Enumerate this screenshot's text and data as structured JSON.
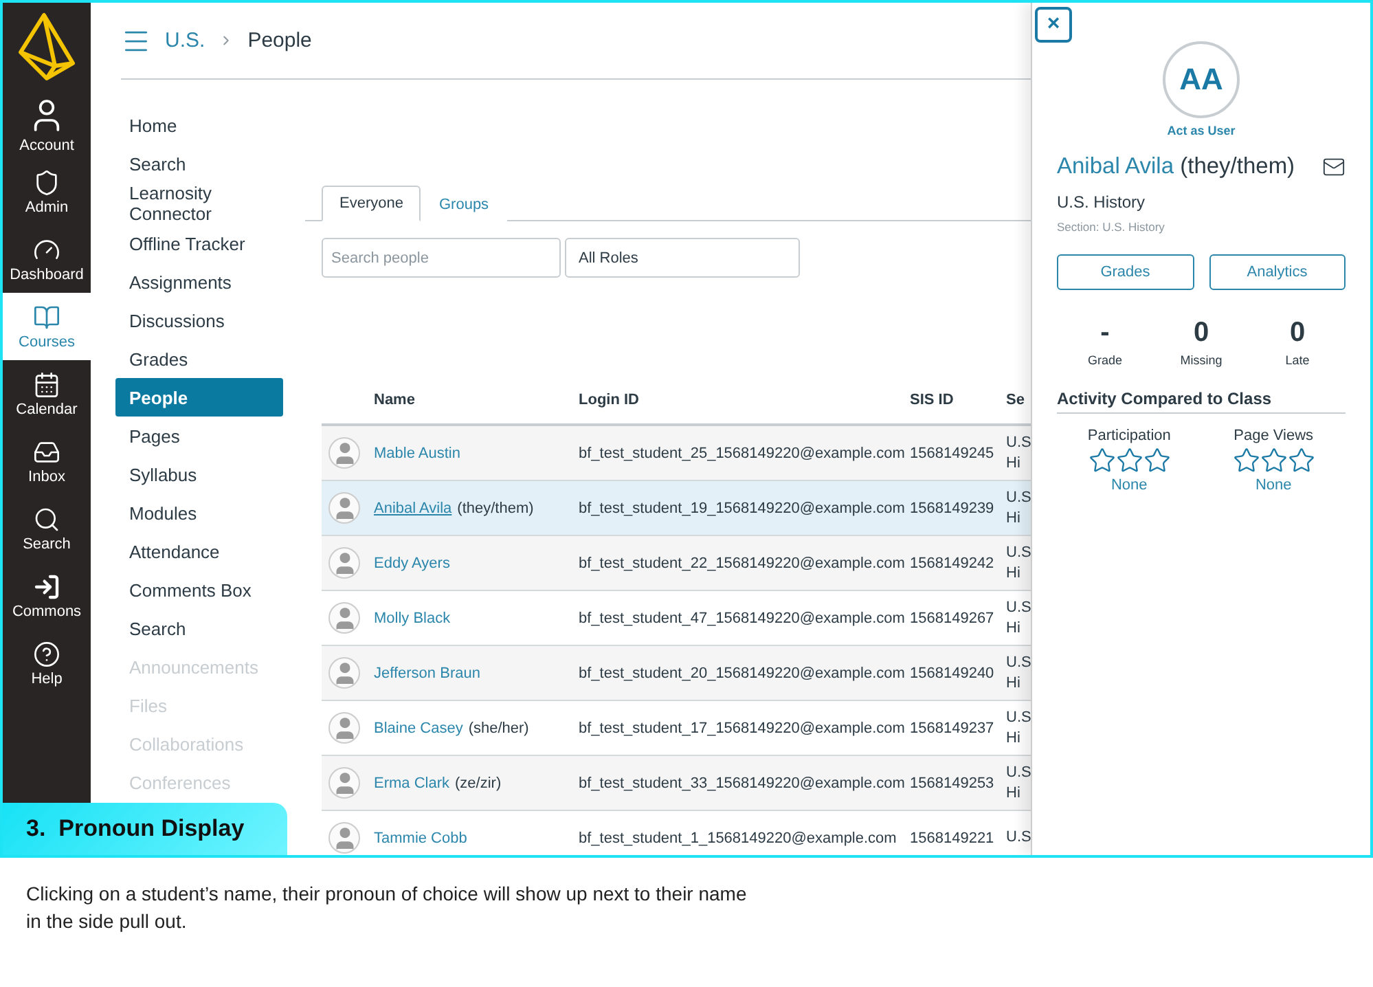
{
  "global_nav": [
    {
      "kind": "account",
      "label": "Account",
      "selected": false
    },
    {
      "kind": "admin",
      "label": "Admin",
      "selected": false
    },
    {
      "kind": "dashboard",
      "label": "Dashboard",
      "selected": false
    },
    {
      "kind": "courses",
      "label": "Courses",
      "selected": true
    },
    {
      "kind": "calendar",
      "label": "Calendar",
      "selected": false
    },
    {
      "kind": "inbox",
      "label": "Inbox",
      "selected": false
    },
    {
      "kind": "search",
      "label": "Search",
      "selected": false
    },
    {
      "kind": "commons",
      "label": "Commons",
      "selected": false
    },
    {
      "kind": "help",
      "label": "Help",
      "selected": false
    }
  ],
  "breadcrumb": [
    "U.S.",
    "People"
  ],
  "course_nav": [
    {
      "label": "Home",
      "selected": false,
      "disabled": false
    },
    {
      "label": "Search",
      "selected": false,
      "disabled": false
    },
    {
      "label": "Learnosity Connector",
      "selected": false,
      "disabled": false
    },
    {
      "label": "Offline Tracker",
      "selected": false,
      "disabled": false
    },
    {
      "label": "Assignments",
      "selected": false,
      "disabled": false
    },
    {
      "label": "Discussions",
      "selected": false,
      "disabled": false
    },
    {
      "label": "Grades",
      "selected": false,
      "disabled": false
    },
    {
      "label": "People",
      "selected": true,
      "disabled": false
    },
    {
      "label": "Pages",
      "selected": false,
      "disabled": false
    },
    {
      "label": "Syllabus",
      "selected": false,
      "disabled": false
    },
    {
      "label": "Modules",
      "selected": false,
      "disabled": false
    },
    {
      "label": "Attendance",
      "selected": false,
      "disabled": false
    },
    {
      "label": "Comments Box",
      "selected": false,
      "disabled": false
    },
    {
      "label": "Search",
      "selected": false,
      "disabled": false
    },
    {
      "label": "Announcements",
      "selected": false,
      "disabled": true
    },
    {
      "label": "Files",
      "selected": false,
      "disabled": true
    },
    {
      "label": "Collaborations",
      "selected": false,
      "disabled": true
    },
    {
      "label": "Conferences",
      "selected": false,
      "disabled": true
    }
  ],
  "tabs": [
    {
      "label": "Everyone",
      "selected": true
    },
    {
      "label": "Groups",
      "selected": false
    }
  ],
  "search": {
    "placeholder": "Search people"
  },
  "role_filter": {
    "value": "All Roles"
  },
  "table": {
    "columns": [
      "Name",
      "Login ID",
      "SIS ID",
      "Se"
    ],
    "rows": [
      {
        "name": "Mable Austin",
        "login_id": "bf_test_student_25_1568149220@example.com",
        "sis_id": "1568149245",
        "section": [
          "U.S",
          "Hi"
        ],
        "selected": false
      },
      {
        "name": "Anibal Avila",
        "pronouns": "(they/them)",
        "login_id": "bf_test_student_19_1568149220@example.com",
        "sis_id": "1568149239",
        "section": [
          "U.S",
          "Hi"
        ],
        "selected": true
      },
      {
        "name": "Eddy Ayers",
        "login_id": "bf_test_student_22_1568149220@example.com",
        "sis_id": "1568149242",
        "section": [
          "U.S",
          "Hi"
        ],
        "selected": false
      },
      {
        "name": "Molly Black",
        "login_id": "bf_test_student_47_1568149220@example.com",
        "sis_id": "1568149267",
        "section": [
          "U.S",
          "Hi"
        ],
        "selected": false
      },
      {
        "name": "Jefferson Braun",
        "login_id": "bf_test_student_20_1568149220@example.com",
        "sis_id": "1568149240",
        "section": [
          "U.S",
          "Hi"
        ],
        "selected": false
      },
      {
        "name": "Blaine Casey",
        "pronouns": "(she/her)",
        "login_id": "bf_test_student_17_1568149220@example.com",
        "sis_id": "1568149237",
        "section": [
          "U.S",
          "Hi"
        ],
        "selected": false
      },
      {
        "name": "Erma Clark",
        "pronouns": "(ze/zir)",
        "login_id": "bf_test_student_33_1568149220@example.com",
        "sis_id": "1568149253",
        "section": [
          "U.S",
          "Hi"
        ],
        "selected": false
      },
      {
        "name": "Tammie Cobb",
        "login_id": "bf_test_student_1_1568149220@example.com",
        "sis_id": "1568149221",
        "section": [
          "U.S"
        ],
        "selected": false
      }
    ]
  },
  "user_panel": {
    "close": "×",
    "initials": "AA",
    "act_as": "Act as User",
    "name": "Anibal Avila",
    "pronouns": "(they/them)",
    "course": "U.S. History",
    "section": "Section: U.S. History",
    "buttons": [
      "Grades",
      "Analytics"
    ],
    "stats": [
      {
        "value": "-",
        "label": "Grade"
      },
      {
        "value": "0",
        "label": "Missing"
      },
      {
        "value": "0",
        "label": "Late"
      }
    ],
    "activity_title": "Activity Compared to Class",
    "activity": [
      {
        "label": "Participation",
        "stars": 0,
        "rating": "None"
      },
      {
        "label": "Page Views",
        "stars": 0,
        "rating": "None"
      }
    ]
  },
  "callout": {
    "title": "3.  Pronoun Display",
    "description": "Clicking on a student’s name, their pronoun of choice will show up next to their name in the side pull out."
  }
}
